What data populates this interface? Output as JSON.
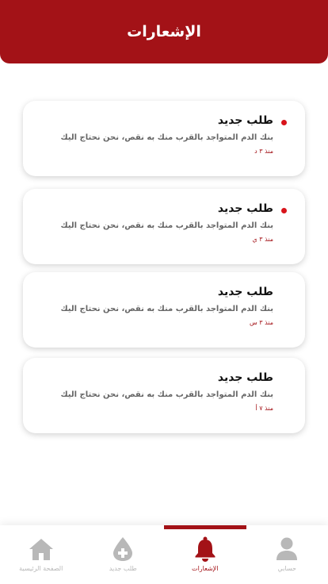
{
  "header": {
    "title": "الإشعارات"
  },
  "notifications": [
    {
      "title": "طلب جديد",
      "body": "بنك الدم المتواجد بالقرب منك به نقص، نحن نحتاج اليك",
      "time": "منذ ٣ د",
      "unread": true
    },
    {
      "title": "طلب جديد",
      "body": "بنك الدم المتواجد بالقرب منك به نقص، نحن نحتاج اليك",
      "time": "منذ ٣ ي",
      "unread": true
    },
    {
      "title": "طلب جديد",
      "body": "بنك الدم المتواجد بالقرب منك به نقص، نحن نحتاج اليك",
      "time": "منذ ٣ س",
      "unread": false
    },
    {
      "title": "طلب جديد",
      "body": "بنك الدم المتواجد بالقرب منك به نقص، نحن نحتاج اليك",
      "time": "منذ ٧ أ",
      "unread": false
    }
  ],
  "bottom_nav": {
    "items": [
      {
        "label": "الصفحة الرئيسية",
        "icon": "home-icon"
      },
      {
        "label": "طلب جديد",
        "icon": "blood-drop-plus-icon"
      },
      {
        "label": "الإشعارات",
        "icon": "bell-icon",
        "active": true
      },
      {
        "label": "حسابي",
        "icon": "user-icon"
      }
    ]
  },
  "colors": {
    "accent": "#a31217",
    "unread_dot": "#d8141b",
    "inactive": "#b8b8b8"
  }
}
